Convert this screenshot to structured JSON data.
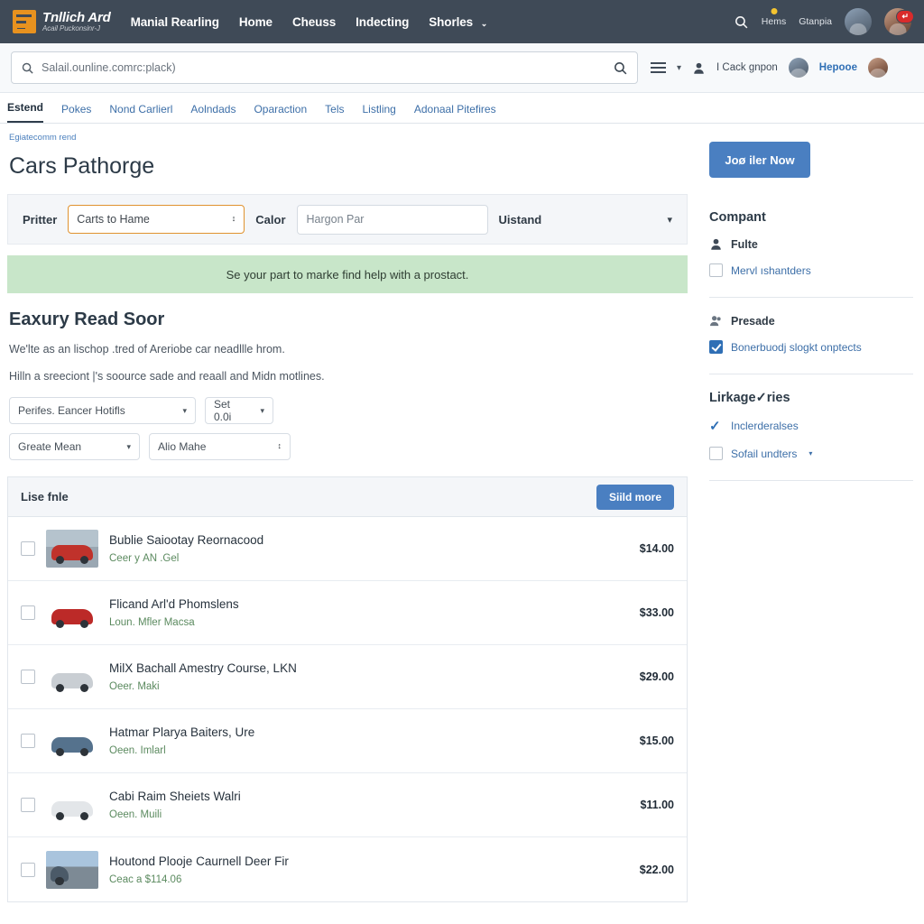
{
  "topnav": {
    "logo_title": "Tnllich Ard",
    "logo_subtitle": "Acail Puckonsinr-J",
    "links": [
      {
        "label": "Manial Rearling"
      },
      {
        "label": "Home"
      },
      {
        "label": "Cheuss"
      },
      {
        "label": "Indecting"
      },
      {
        "label": "Shorles",
        "caret": "⌄"
      }
    ],
    "search_icon": "search-icon",
    "items": [
      {
        "label": "Hems",
        "badge_dot": true
      },
      {
        "label": "Gtanpia",
        "badge_dot": false
      }
    ],
    "avatar_badge": "↵"
  },
  "search": {
    "value": "",
    "placeholder": "Salail.ounline.comrc:plack)",
    "leading_icon": "search-icon",
    "trailing_icon": "search-icon",
    "menu_icon": "hamburger-icon",
    "caret": "▾",
    "account_label": "I Cack gnpon",
    "profile_label": "Hepooe"
  },
  "tabs": [
    {
      "label": "Estend",
      "active": true
    },
    {
      "label": "Pokes",
      "active": false
    },
    {
      "label": "Nond Carlierl",
      "active": false
    },
    {
      "label": "Aolndads",
      "active": false
    },
    {
      "label": "Oparaction",
      "active": false
    },
    {
      "label": "Tels",
      "active": false
    },
    {
      "label": "Listling",
      "active": false
    },
    {
      "label": "Adonaal Pitefires",
      "active": false
    }
  ],
  "page": {
    "breadcrumb": "Egiatecomm rend",
    "title": "Cars Pathorge"
  },
  "filterbar": {
    "label_1": "Pritter",
    "select_value": "Carts to Hame",
    "select_arrows": "↕",
    "label_2": "Calor",
    "input_value": "",
    "input_placeholder": "Hargon Par",
    "label_3": "Uistand",
    "caret": "▾"
  },
  "banner": {
    "text": "Se your part to marke find help with a prostact."
  },
  "section": {
    "title": "Eaxury Read Soor",
    "para_1": "We'lte as an lischop .tred of Areriobe car neadllle hrom.",
    "para_2": "Hilln a sreeciont |'s soource sade and reaall and Midn motlines."
  },
  "dropdowns": [
    {
      "label": "Perifes. Eancer Hotifls",
      "caret": "▾"
    },
    {
      "label": "Set 0.0i",
      "caret": "▾"
    },
    {
      "label": "Greate Mean",
      "caret": "▾"
    },
    {
      "label": "Alio Mahe",
      "arrows": "↕"
    }
  ],
  "list": {
    "header_title": "Lise fnle",
    "header_button": "Siild more",
    "rows": [
      {
        "title": "Bublie Saiootay Reornacood",
        "sub": "Ceer у AN .Gel",
        "price": "$14.00",
        "thumb": "red"
      },
      {
        "title": "Flicand Arl'd Phomslens",
        "sub": "Loun. Mfler Macsa",
        "price": "$33.00",
        "thumb": "red2"
      },
      {
        "title": "MilX Bachall Amestry Course, LKN",
        "sub": "Oeer. Maki",
        "price": "$29.00",
        "thumb": "silver"
      },
      {
        "title": "Hatmar Plarya Baiters, Ure",
        "sub": "Oeen. Imlarl",
        "price": "$15.00",
        "thumb": "blue"
      },
      {
        "title": "Cabi Raim Sheiets Walri",
        "sub": "Oeen. Muili",
        "price": "$11.00",
        "thumb": "white"
      },
      {
        "title": "Houtond Plooje Caurnell Deer Fir",
        "sub": "Ceac a $114.06",
        "price": "$22.00",
        "thumb": "lot"
      }
    ]
  },
  "sidebar": {
    "cta_button": "Joø iler Now",
    "company_heading": "Compant",
    "company_person": "Fulte",
    "company_check": "Mervl ıshantders",
    "presade_heading": "Presade",
    "presade_link": "Bonerbuodj slogkt onptects",
    "linkage_heading": "Lirkage✓ries",
    "linkage_item_1": "Inclerderalses",
    "linkage_item_2": "Sofail undters",
    "linkage_item_2_caret": "▾"
  },
  "colors": {
    "nav_bg": "#3f4a57",
    "accent_orange": "#e0922f",
    "primary_blue": "#4a7fc1",
    "link_blue": "#3d6fa8",
    "banner_green": "#c8e6c9",
    "sub_green": "#5b8a5f"
  }
}
